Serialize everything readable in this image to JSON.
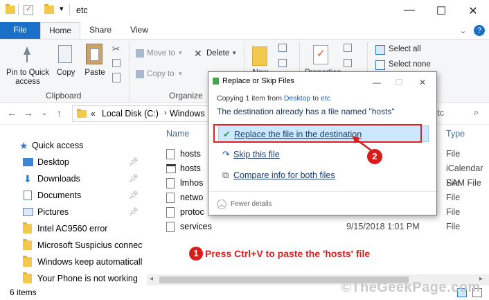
{
  "window": {
    "path_title": "etc"
  },
  "title_controls": {
    "minimize": "—",
    "maximize": "☐",
    "close": "✕"
  },
  "tabs": [
    {
      "label": "File"
    },
    {
      "label": "Home"
    },
    {
      "label": "Share"
    },
    {
      "label": "View"
    }
  ],
  "help": "?",
  "ribbon": {
    "clipboard": {
      "pin": "Pin to Quick access",
      "copy": "Copy",
      "paste": "Paste",
      "group": "Clipboard"
    },
    "organize": {
      "move_to": "Move to",
      "copy_to": "Copy to",
      "delete": "Delete",
      "group": "Organize"
    },
    "new_label": "New",
    "open_label": "Properties",
    "select": {
      "all": "Select all",
      "none": "Select none"
    }
  },
  "address": {
    "crumb_prefix": "«",
    "crumbs": [
      "Local Disk (C:)",
      "Windows"
    ],
    "search_suffix": "n etc"
  },
  "nav": {
    "quick_access": "Quick access",
    "items": [
      {
        "label": "Desktop",
        "pinned": true,
        "icon": "desktop-icon"
      },
      {
        "label": "Downloads",
        "pinned": true,
        "icon": "download-icon"
      },
      {
        "label": "Documents",
        "pinned": true,
        "icon": "documents-icon"
      },
      {
        "label": "Pictures",
        "pinned": true,
        "icon": "pictures-icon"
      },
      {
        "label": "Intel AC9560 error",
        "pinned": false,
        "icon": "folder-icon"
      },
      {
        "label": "Microsoft Suspicius connect",
        "pinned": false,
        "icon": "folder-icon"
      },
      {
        "label": "Windows keep automatically",
        "pinned": false,
        "icon": "folder-icon"
      },
      {
        "label": "Your Phone is not working",
        "pinned": false,
        "icon": "folder-icon"
      }
    ]
  },
  "columns": {
    "name": "Name",
    "type": "Type"
  },
  "files": [
    {
      "name": "hosts",
      "date": "",
      "type": "File"
    },
    {
      "name": "hosts",
      "date": "",
      "type": "iCalendar File"
    },
    {
      "name": "lmhos",
      "date": "",
      "type": "SAM File"
    },
    {
      "name": "netwo",
      "date": "",
      "type": "File"
    },
    {
      "name": "protoc",
      "date": "9/15/2018 1:01 PM",
      "type": "File"
    },
    {
      "name": "services",
      "date": "9/15/2018 1:01 PM",
      "type": "File"
    }
  ],
  "status": {
    "count": "6 items"
  },
  "dialog": {
    "title": "Replace or Skip Files",
    "copying_prefix": "Copying 1 item from",
    "copying_from": "Desktop",
    "copying_to_word": "to",
    "copying_to": "etc",
    "message": "The destination already has a file named \"hosts\"",
    "options": [
      {
        "label": "Replace the file in the destination",
        "icon": "check-icon"
      },
      {
        "label": "Skip this file",
        "icon": "skip-icon"
      },
      {
        "label": "Compare info for both files",
        "icon": "compare-icon"
      }
    ],
    "fewer": "Fewer details",
    "controls": {
      "min": "—",
      "max": "☐",
      "close": "✕"
    }
  },
  "annotations": {
    "step1_num": "1",
    "step1_text": "Press Ctrl+V to paste the 'hosts' file",
    "step2_num": "2"
  },
  "watermark": "©TheGeekPage.com",
  "colors": {
    "accent": "#1a6fc9",
    "annotation": "#d91c1c",
    "selection": "#cce8ff"
  }
}
